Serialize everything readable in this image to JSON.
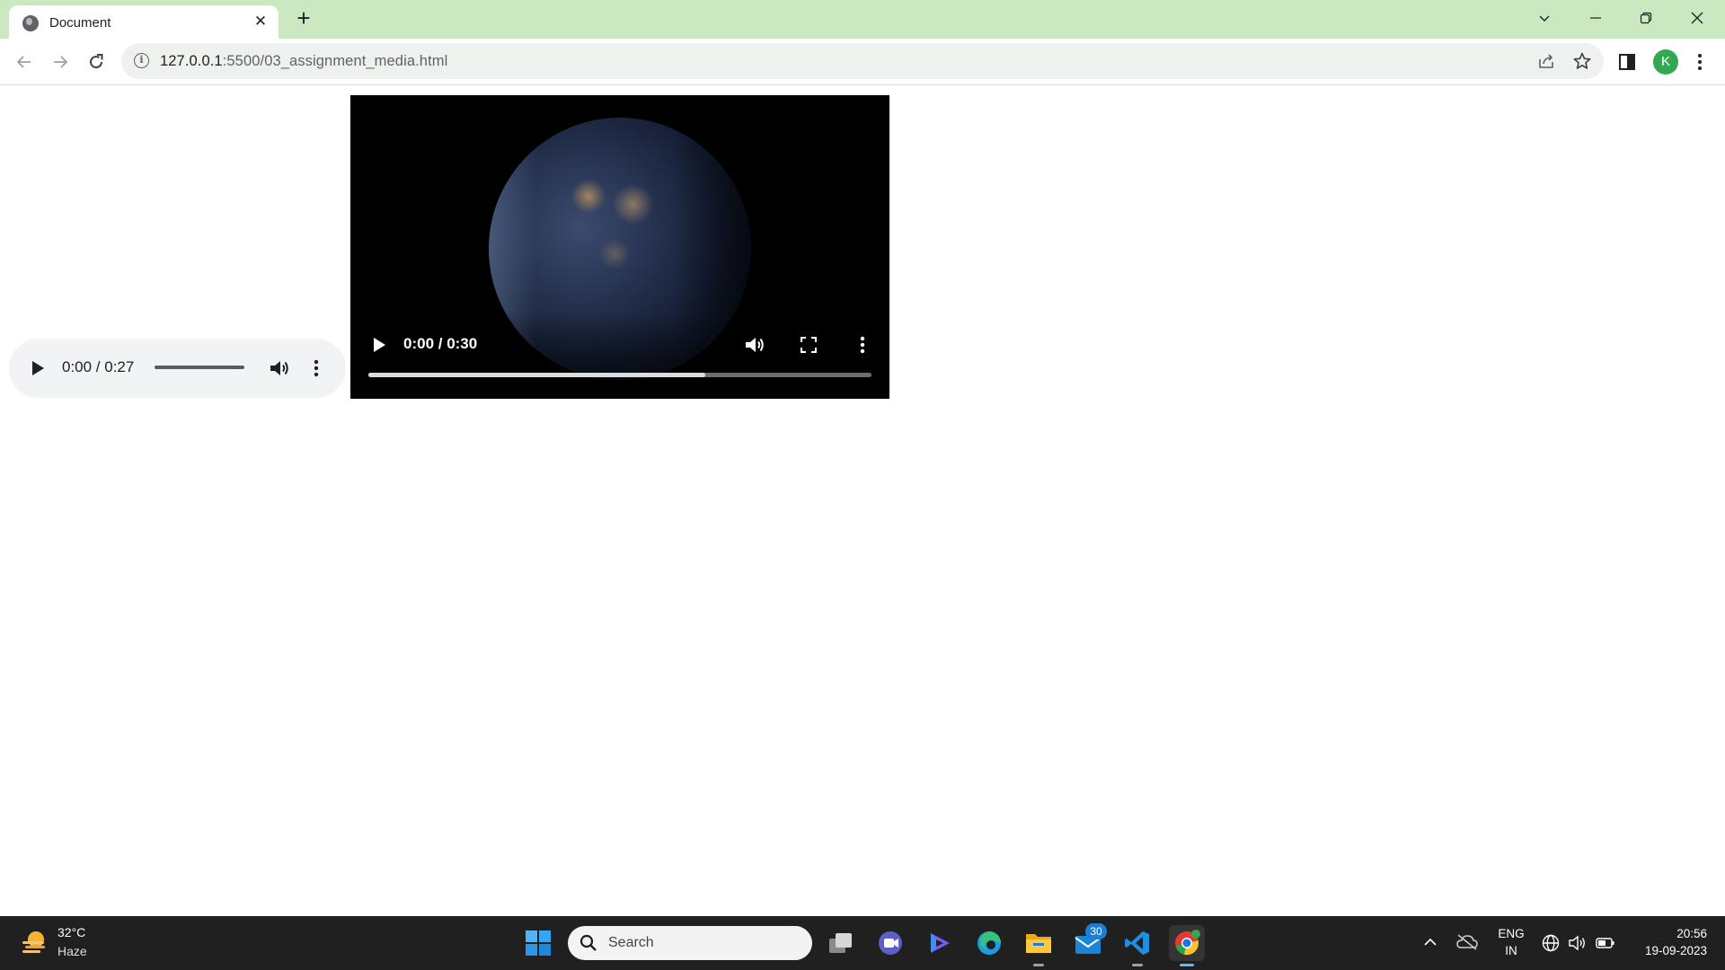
{
  "browser": {
    "tab": {
      "title": "Document",
      "favicon": "globe-icon"
    },
    "address_bar": {
      "host": "127.0.0.1",
      "path": ":5500/03_assignment_media.html"
    },
    "profile_initial": "K",
    "accent_color": "#cbe9c1"
  },
  "page": {
    "audio_player": {
      "time": "0:00 / 0:27",
      "progress": 0
    },
    "video_player": {
      "time": "0:00 / 0:30",
      "buffered_fraction": 0.67
    }
  },
  "taskbar": {
    "weather": {
      "temperature": "32°C",
      "condition": "Haze"
    },
    "search_label": "Search",
    "apps": [
      "windows-start-icon",
      "search-icon",
      "task-view-icon",
      "teams-icon",
      "copilot-icon",
      "edge-icon",
      "file-explorer-icon",
      "mail-icon",
      "vscode-icon",
      "chrome-icon"
    ],
    "mail_badge": "30",
    "language": {
      "line1": "ENG",
      "line2": "IN"
    },
    "clock": {
      "time": "20:56",
      "date": "19-09-2023"
    }
  }
}
